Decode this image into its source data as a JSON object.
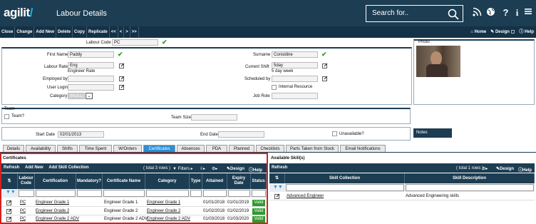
{
  "app": {
    "logo": "agilit",
    "title": "Labour Details",
    "search_placeholder": "Search for.."
  },
  "header_icons": [
    "rss-icon",
    "globe-icon",
    "help-icon",
    "info-icon"
  ],
  "toolbar": {
    "items": [
      "Close",
      "Change",
      "Add New",
      "Delete",
      "Copy",
      "Replicate",
      "<<",
      "<",
      ">",
      ">>"
    ],
    "home": "Home",
    "design": "Design",
    "help": "Help"
  },
  "form": {
    "labour_code_label": "Labour Code",
    "labour_code": "PC",
    "first_name_label": "First Name",
    "first_name": "Paddy",
    "surname_label": "Surname",
    "surname": "Considine",
    "labour_rate_label": "Labour Rate",
    "labour_rate": "Eng",
    "labour_rate_desc": "Engineer Rate",
    "current_shift_label": "Current Shift",
    "current_shift": "5day",
    "current_shift_desc": "5 day week",
    "employed_by_label": "Employed by",
    "scheduled_by_label": "Scheduled by",
    "user_login_label": "User Login",
    "internal_resource_label": "Internal Resource",
    "category_label": "Category",
    "category": "(NULL)",
    "job_role_label": "Job Role",
    "photo_label": "Photo"
  },
  "team": {
    "title": "Team",
    "team_label": "Team?",
    "team_size_label": "Team Size"
  },
  "dates": {
    "start_label": "Start Date",
    "start": "02/01/2013",
    "end_label": "End Date",
    "unavailable_label": "Unavailable?",
    "notes": "Notes"
  },
  "tabs": [
    "Details",
    "Availability",
    "Shifts",
    "Time Spent",
    "W/Orders",
    "Certificates",
    "Absences",
    "PDA",
    "Planned",
    "Checklists",
    "Parts Taken from Stock",
    "Email Notifications"
  ],
  "active_tab": "Certificates",
  "certs": {
    "title": "Certificates",
    "actions": [
      "Refresh",
      "Add New",
      "Add Skill Collection"
    ],
    "rows_info": "( total 3 rows )",
    "filters": "Filters",
    "design": "Design",
    "help": "Help",
    "columns": [
      "Labour Code",
      "Certification",
      "Mandatory?",
      "Certificate Name",
      "Category",
      "Type",
      "Attained",
      "Expiry Date",
      "Status"
    ],
    "rows": [
      {
        "code": "PC",
        "cert": "Engineer Grade 1",
        "name": "Engineer Grade 1",
        "cat": "Engineer Grade 1",
        "attained": "01/01/2018",
        "expiry": "01/01/2019",
        "status": "Valid"
      },
      {
        "code": "PC",
        "cert": "Engineer Grade 2",
        "name": "Engineer Grade 2",
        "cat": "Engineer Grade 2",
        "attained": "01/02/2018",
        "expiry": "01/02/2019",
        "status": "Valid"
      },
      {
        "code": "PC",
        "cert": "Engineer Grade 2 ADV",
        "name": "Engineer Grade 2 ADV",
        "cat": "Engineer Grade 2 ADV",
        "attained": "01/03/2018",
        "expiry": "01/03/2020",
        "status": "Valid"
      }
    ]
  },
  "skills": {
    "title": "Available Skill(s)",
    "refresh": "Refresh",
    "rows_info": "( total 1 rows )",
    "design": "Design",
    "help": "Help",
    "columns": [
      "Skill Collection",
      "Skill Description"
    ],
    "rows": [
      {
        "collection": "Advanced Engineer",
        "description": "Advanced Engineering skills"
      }
    ]
  }
}
